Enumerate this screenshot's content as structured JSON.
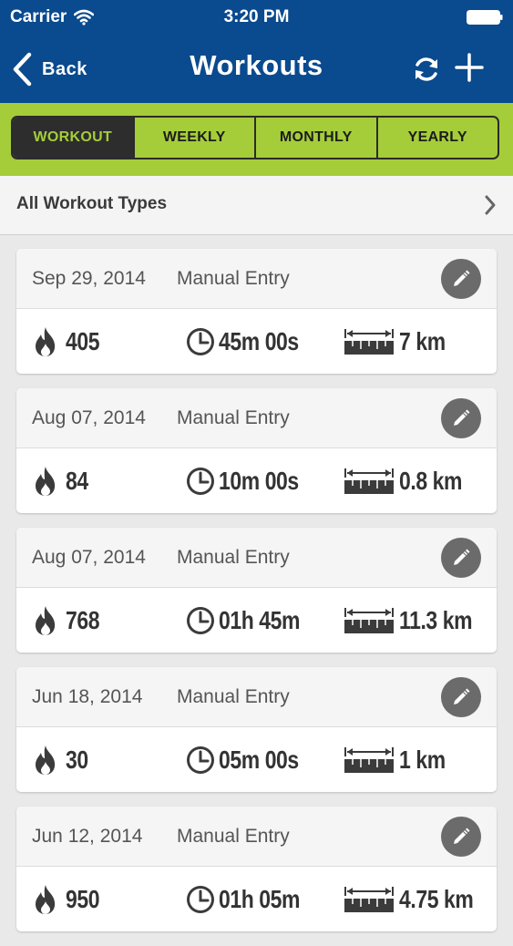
{
  "status_bar": {
    "carrier": "Carrier",
    "time": "3:20 PM"
  },
  "nav": {
    "back_label": "Back",
    "title": "Workouts"
  },
  "segments": [
    "WORKOUT",
    "WEEKLY",
    "MONTHLY",
    "YEARLY"
  ],
  "selected_segment": "WORKOUT",
  "filter": {
    "label": "All Workout Types"
  },
  "workouts": [
    {
      "date": "Sep 29, 2014",
      "source": "Manual Entry",
      "calories": "405",
      "duration": "45m 00s",
      "distance": "7 km"
    },
    {
      "date": "Aug 07, 2014",
      "source": "Manual Entry",
      "calories": "84",
      "duration": "10m 00s",
      "distance": "0.8 km"
    },
    {
      "date": "Aug 07, 2014",
      "source": "Manual Entry",
      "calories": "768",
      "duration": "01h 45m",
      "distance": "11.3 km"
    },
    {
      "date": "Jun 18, 2014",
      "source": "Manual Entry",
      "calories": "30",
      "duration": "05m 00s",
      "distance": "1 km"
    },
    {
      "date": "Jun 12, 2014",
      "source": "Manual Entry",
      "calories": "950",
      "duration": "01h 05m",
      "distance": "4.75 km"
    }
  ],
  "icons": {
    "calories": "flame-icon",
    "duration": "clock-icon",
    "distance": "ruler-icon",
    "edit": "pencil-icon",
    "refresh": "refresh-icon",
    "add": "plus-icon"
  },
  "colors": {
    "header_bg": "#0a4a8e",
    "accent_green": "#a5cd39",
    "segment_active_bg": "#2d2d2d",
    "edit_button_bg": "#6b6b6b",
    "page_bg": "#e9e9e9"
  }
}
